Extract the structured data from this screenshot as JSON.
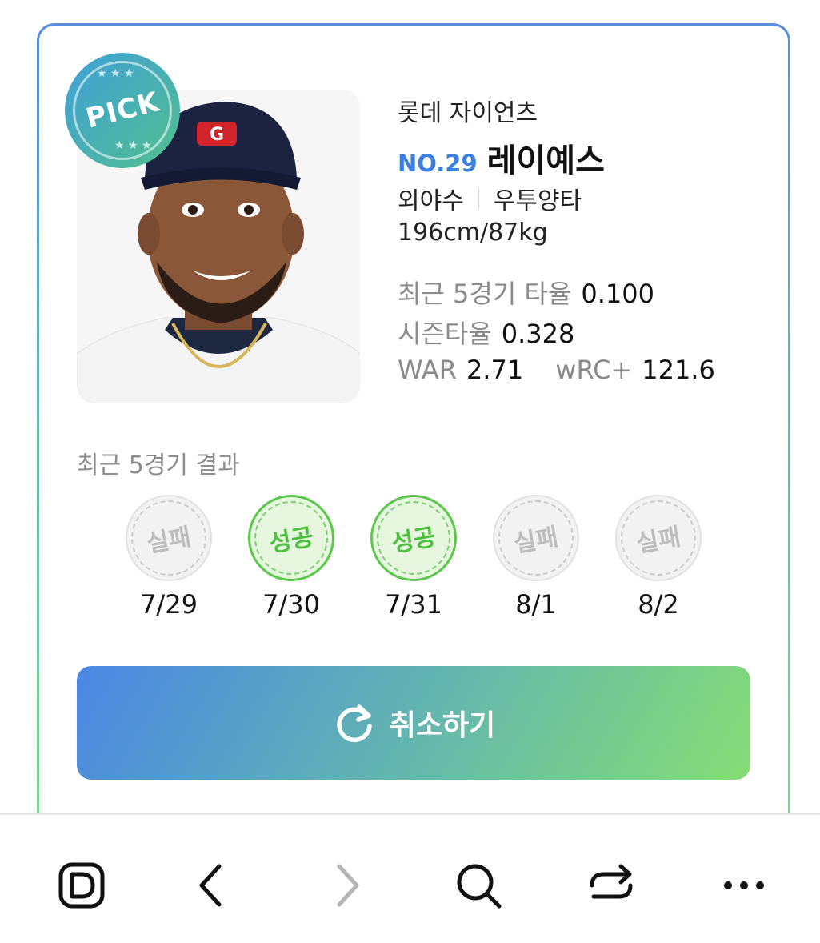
{
  "pick_badge": {
    "label": "PICK"
  },
  "player": {
    "team": "롯데 자이언츠",
    "number": "NO.29",
    "name": "레이예스",
    "position": "외야수",
    "bats_throws": "우투양타",
    "body": "196cm/87kg"
  },
  "stats": {
    "recent5_label": "최근 5경기 타율",
    "recent5_value": "0.100",
    "season_label": "시즌타율",
    "season_value": "0.328",
    "war_label": "WAR",
    "war_value": "2.71",
    "wrc_label": "wRC+",
    "wrc_value": "121.6"
  },
  "recent_results": {
    "title": "최근 5경기 결과",
    "games": [
      {
        "result": "실패",
        "status": "fail",
        "date": "7/29"
      },
      {
        "result": "성공",
        "status": "success",
        "date": "7/30"
      },
      {
        "result": "성공",
        "status": "success",
        "date": "7/31"
      },
      {
        "result": "실패",
        "status": "fail",
        "date": "8/1"
      },
      {
        "result": "실패",
        "status": "fail",
        "date": "8/2"
      }
    ]
  },
  "cancel_button": {
    "label": "취소하기",
    "icon": "refresh-icon"
  },
  "bottom_nav": {
    "items": [
      "d-logo-icon",
      "back-icon",
      "forward-icon",
      "search-icon",
      "tabs-switch-icon",
      "more-icon"
    ]
  },
  "colors": {
    "accent_blue": "#3b7fe0",
    "success_green": "#5cc84b",
    "fail_gray": "#bdbdbd"
  }
}
